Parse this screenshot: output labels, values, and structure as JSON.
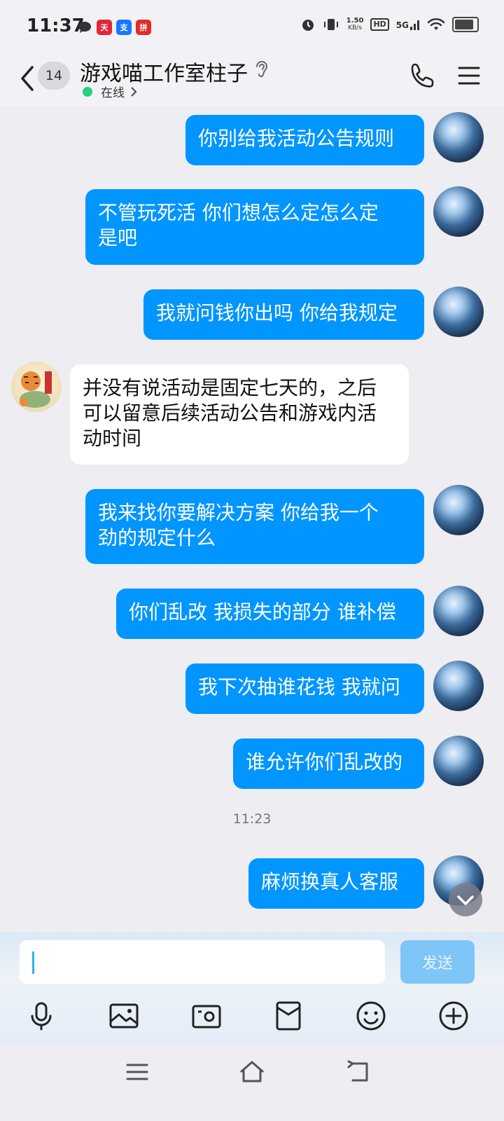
{
  "status_bar": {
    "time": "11:37",
    "net_speed_value": "1.50",
    "net_speed_unit": "KB/s",
    "hd_label": "HD",
    "signal_label": "5G",
    "app_icons": [
      "chat-bubble-icon",
      "tmall-icon",
      "alipay-icon",
      "pinduoduo-icon"
    ],
    "status_icons": [
      "alarm-icon",
      "vibrate-icon",
      "wifi-icon",
      "battery-icon"
    ],
    "battery_level": 0.8
  },
  "header": {
    "unread_count": "14",
    "title": "游戏喵工作室柱子",
    "presence": "在线",
    "presence_color": "#26d07c"
  },
  "messages": [
    {
      "side": "out",
      "text": "你别给我活动公告规则"
    },
    {
      "side": "out",
      "text": "不管玩死活 你们想怎么定怎么定\n是吧"
    },
    {
      "side": "out",
      "text": "我就问钱你出吗 你给我规定"
    },
    {
      "side": "in",
      "text": "并没有说活动是固定七天的，之后\n可以留意后续活动公告和游戏内活\n动时间"
    },
    {
      "side": "out",
      "text": "我来找你要解决方案 你给我一个\n劲的规定什么"
    },
    {
      "side": "out",
      "text": "你们乱改 我损失的部分 谁补偿"
    },
    {
      "side": "out",
      "text": "我下次抽谁花钱 我就问"
    },
    {
      "side": "out",
      "text": "谁允许你们乱改的"
    },
    {
      "side": "out",
      "text": "麻烦换真人客服"
    }
  ],
  "timestamp": "11:23",
  "input": {
    "value": "",
    "send_label": "发送"
  },
  "toolbar_icons": [
    "microphone-icon",
    "image-icon",
    "camera-icon",
    "red-packet-icon",
    "emoji-icon",
    "plus-icon"
  ],
  "nav_icons": [
    "recents-icon",
    "home-icon",
    "back-nav-icon"
  ],
  "colors": {
    "outgoing_bubble": "#0095ff",
    "incoming_bubble": "#ffffff",
    "background": "#ededf2",
    "send_button": "#7ec6f7"
  }
}
